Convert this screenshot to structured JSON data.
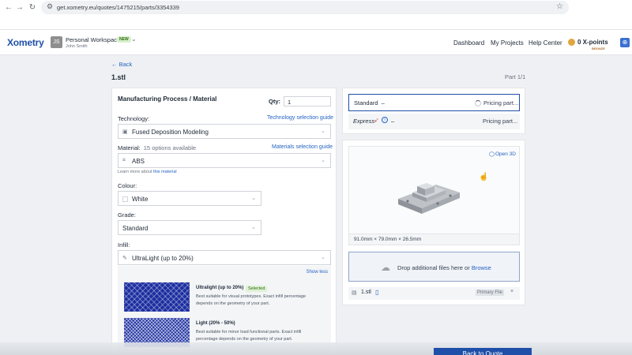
{
  "browser": {
    "url": "get.xometry.eu/quotes/1475215/parts/3354339",
    "back_icon": "arrow-left-icon",
    "forward_icon": "arrow-right-icon",
    "reload_icon": "reload-icon",
    "bookmark_icon": "star-icon"
  },
  "header": {
    "logo": "Xometry",
    "avatar_initials": "JS",
    "workspace": "Personal Workspace",
    "workspace_badge": "NEW",
    "user": "John Smith",
    "nav": [
      "Dashboard",
      "My Projects",
      "Help Center"
    ],
    "points": "0 X-points",
    "points_tier": "BRONZE"
  },
  "page": {
    "back": "← Back",
    "title": "1.stl",
    "part_number": "Part 1/1"
  },
  "config": {
    "title": "Manufacturing Process / Material",
    "qty_label": "Qty:",
    "qty_value": "1",
    "technology_label": "Technology:",
    "technology_link": "Technology selection guide",
    "technology_value": "Fused Deposition Modeling",
    "material_label": "Material:",
    "material_count": "15 options available",
    "material_link": "Materials selection guide",
    "material_value": "ABS",
    "learn_prefix": "Learn more about",
    "learn_link": "this material",
    "colour_label": "Colour:",
    "colour_value": "White",
    "grade_label": "Grade:",
    "grade_value": "Standard",
    "infill_label": "Infill:",
    "infill_value": "UltraLight (up to 20%)",
    "show_less": "Show less",
    "infill_options": [
      {
        "name": "Ultralight (up to 20%)",
        "badge": "Selected",
        "desc": "Best suitable for visual prototypes. Exact infill percentage depends on the geometry of your part."
      },
      {
        "name": "Light (20% - 50%)",
        "desc": "Best suitable for minor load functional parts. Exact infill percentage depends on the geometry of your part."
      }
    ]
  },
  "pricing": {
    "standard_label": "Standard",
    "standard_dash": "–",
    "standard_status": "Pricing part...",
    "express_label": "Express",
    "express_dash": "–",
    "express_status": "Pricing part..."
  },
  "model": {
    "open3d": "Open 3D",
    "dimensions": "91.0mm × 79.0mm × 26.5mm",
    "drop_text": "Drop additional files here or",
    "browse": "Browse",
    "file_name": "1.stl",
    "file_tag": "Primary File"
  },
  "footer": {
    "back_to_quote": "Back to Quote"
  }
}
